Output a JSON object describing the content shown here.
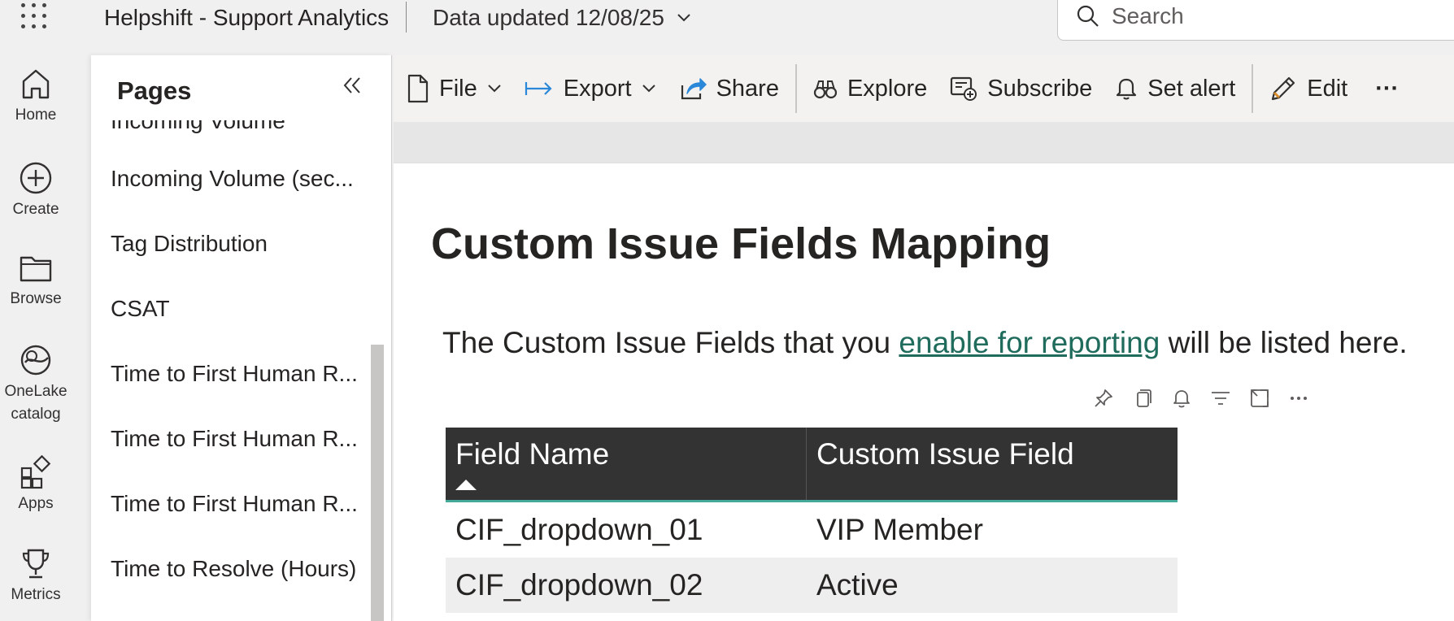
{
  "header": {
    "app_title": "Helpshift - Support Analytics",
    "data_updated": "Data updated 12/08/25",
    "search_placeholder": "Search"
  },
  "rail": {
    "items": [
      {
        "label": "Home",
        "icon": "home-icon"
      },
      {
        "label": "Create",
        "icon": "create-icon"
      },
      {
        "label": "Browse",
        "icon": "folder-icon"
      },
      {
        "label": "OneLake catalog",
        "icon": "onelake-icon"
      },
      {
        "label": "Apps",
        "icon": "apps-icon"
      },
      {
        "label": "Metrics",
        "icon": "trophy-icon"
      }
    ]
  },
  "pages_panel": {
    "title": "Pages",
    "items": [
      "Incoming Volume",
      "Incoming Volume (sec...",
      "Tag Distribution",
      "CSAT",
      "Time to First Human R...",
      "Time to First Human R...",
      "Time to First Human R...",
      "Time to Resolve (Hours)"
    ]
  },
  "toolbar": {
    "file": "File",
    "export": "Export",
    "share": "Share",
    "explore": "Explore",
    "subscribe": "Subscribe",
    "set_alert": "Set alert",
    "edit": "Edit",
    "more": "···"
  },
  "report": {
    "title": "Custom Issue Fields Mapping",
    "desc_before": "The Custom Issue Fields that you ",
    "desc_link": "enable for reporting",
    "desc_after": " will be listed here.",
    "table": {
      "columns": [
        "Field Name",
        "Custom Issue Field"
      ],
      "rows": [
        [
          "CIF_dropdown_01",
          "VIP Member"
        ],
        [
          "CIF_dropdown_02",
          "Active"
        ]
      ]
    }
  },
  "colors": {
    "table_header_bg": "#333333",
    "table_header_accent": "#44a89a",
    "link": "#1f6b5c",
    "share_accent": "#2b88d8"
  }
}
